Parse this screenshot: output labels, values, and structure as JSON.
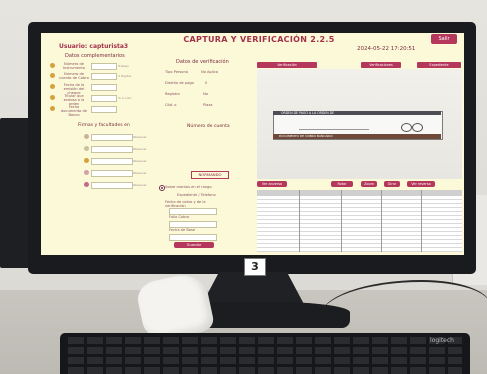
{
  "app": {
    "title": "CAPTURA Y VERIFICACIÓN 2.2.5",
    "user": "Usuario: capturista3",
    "datetime": "2024-05-22 17:20:51",
    "exit_label": "Salir"
  },
  "left": {
    "section_title": "Datos complementarios",
    "fields": [
      {
        "label": "Número de Instrumento",
        "hint": "Trabajo"
      },
      {
        "label": "Número de cuenta de Cobro",
        "hint": "3 Dígitos"
      },
      {
        "label": "Fecha de la emisión del cheque",
        "hint": ""
      },
      {
        "label": "Titular que endosa a la orden",
        "hint": "% 2 núm"
      },
      {
        "label": "Fecha documento de Banco",
        "hint": ""
      }
    ]
  },
  "middle": {
    "section_title": "Datos de verificación",
    "rows": [
      {
        "label": "Tipo Persona",
        "value": "No Aplica"
      },
      {
        "label": "Distrito de pago",
        "value": "0"
      },
      {
        "label": "Registro",
        "value": "No"
      },
      {
        "label": "Cód. o",
        "value": "Plaza"
      }
    ],
    "amount_title": "Número de cuenta"
  },
  "bottom_left": {
    "title": "Firmas y facultades en",
    "hints": [
      "Observar",
      "Observar",
      "Observar",
      "Observar",
      "Observar"
    ]
  },
  "mid_bottom": {
    "button_label": "NORMANDO",
    "radio_label": "Sobre montos en el rango",
    "subtitle": "Expediente / Telefono",
    "fields": [
      "Fecha de cobro y de la verificación",
      "Folio Cobro",
      "Fecha de Base"
    ],
    "submit_label": "Guardar"
  },
  "tabs": [
    "Verificación",
    "Verificaciones",
    "Expediente"
  ],
  "check": {
    "top_text": "ORDEN DE PAGO A LA ORDEN DE",
    "bottom_text": "DOCUMENTO DE COBRO BANCARIO"
  },
  "action_buttons": [
    "Ver anverso",
    "Rotar",
    "Zoom",
    "Girar",
    "Ver reverso"
  ]
}
